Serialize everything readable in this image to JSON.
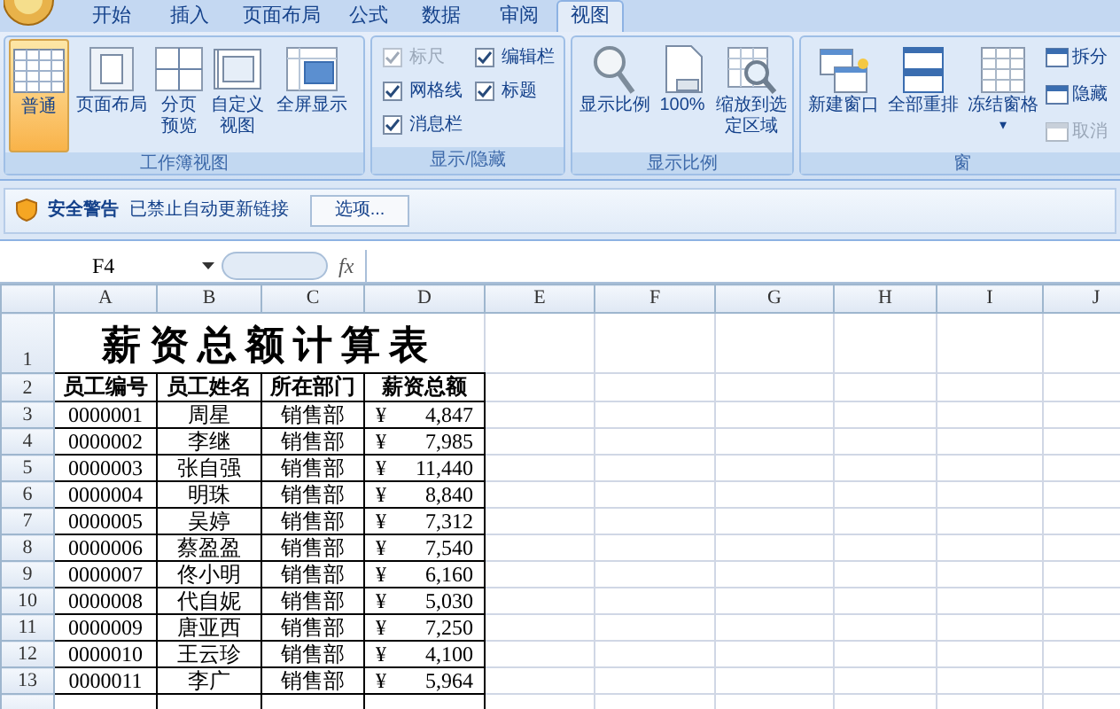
{
  "tabs": [
    {
      "label": "开始",
      "selected": false
    },
    {
      "label": "插入",
      "selected": false
    },
    {
      "label": "页面布局",
      "selected": false
    },
    {
      "label": "公式",
      "selected": false
    },
    {
      "label": "数据",
      "selected": false
    },
    {
      "label": "审阅",
      "selected": false
    },
    {
      "label": "视图",
      "selected": true
    }
  ],
  "ribbon_groups": [
    {
      "label": "工作簿视图",
      "items": [
        {
          "kind": "large",
          "label": "普通",
          "selected": true
        },
        {
          "kind": "large",
          "label": "页面布局",
          "selected": false
        },
        {
          "kind": "large",
          "label": "分页预览",
          "selected": false
        },
        {
          "kind": "large",
          "label": "自定义视图",
          "selected": false
        },
        {
          "kind": "large",
          "label": "全屏显示",
          "selected": false
        }
      ]
    },
    {
      "label": "显示/隐藏",
      "items": [
        {
          "kind": "check",
          "label": "标尺",
          "checked": true,
          "disabled": true
        },
        {
          "kind": "check",
          "label": "编辑栏",
          "checked": true,
          "disabled": false
        },
        {
          "kind": "check",
          "label": "网格线",
          "checked": true,
          "disabled": false
        },
        {
          "kind": "check",
          "label": "标题",
          "checked": true,
          "disabled": false
        },
        {
          "kind": "check",
          "label": "消息栏",
          "checked": true,
          "disabled": false
        }
      ]
    },
    {
      "label": "显示比例",
      "items": [
        {
          "kind": "large",
          "label": "显示比例",
          "selected": false
        },
        {
          "kind": "large",
          "label": "100%",
          "selected": false
        },
        {
          "kind": "large",
          "label": "缩放到选定区域",
          "selected": false
        }
      ]
    },
    {
      "label": "窗",
      "items": [
        {
          "kind": "large",
          "label": "新建窗口",
          "selected": false
        },
        {
          "kind": "large",
          "label": "全部重排",
          "selected": false
        },
        {
          "kind": "large",
          "label": "冻结窗格",
          "selected": false,
          "caret": "▾"
        },
        {
          "kind": "small",
          "label": "拆分",
          "disabled": false
        },
        {
          "kind": "small",
          "label": "隐藏",
          "disabled": false
        },
        {
          "kind": "small",
          "label": "取消",
          "disabled": true
        }
      ]
    }
  ],
  "message_bar": {
    "title": "安全警告",
    "text": "已禁止自动更新链接",
    "button": "选项..."
  },
  "formula_bar": {
    "name_box": "F4",
    "fx": "fx"
  },
  "sheet": {
    "columns": [
      "A",
      "B",
      "C",
      "D",
      "E",
      "F",
      "G",
      "H",
      "I",
      "J"
    ],
    "row_headers": [
      "1",
      "2",
      "3",
      "4",
      "5",
      "6",
      "7",
      "8",
      "9",
      "10",
      "11",
      "12",
      "13"
    ],
    "title": "薪资总额计算表",
    "headers": [
      "员工编号",
      "员工姓名",
      "所在部门",
      "薪资总额"
    ],
    "rows": [
      {
        "id": "0000001",
        "name": "周星",
        "dept": "销售部",
        "currency": "¥",
        "amount": "4,847"
      },
      {
        "id": "0000002",
        "name": "李继",
        "dept": "销售部",
        "currency": "¥",
        "amount": "7,985"
      },
      {
        "id": "0000003",
        "name": "张自强",
        "dept": "销售部",
        "currency": "¥",
        "amount": "11,440"
      },
      {
        "id": "0000004",
        "name": "明珠",
        "dept": "销售部",
        "currency": "¥",
        "amount": "8,840"
      },
      {
        "id": "0000005",
        "name": "吴婷",
        "dept": "销售部",
        "currency": "¥",
        "amount": "7,312"
      },
      {
        "id": "0000006",
        "name": "蔡盈盈",
        "dept": "销售部",
        "currency": "¥",
        "amount": "7,540"
      },
      {
        "id": "0000007",
        "name": "佟小明",
        "dept": "销售部",
        "currency": "¥",
        "amount": "6,160"
      },
      {
        "id": "0000008",
        "name": "代自妮",
        "dept": "销售部",
        "currency": "¥",
        "amount": "5,030"
      },
      {
        "id": "0000009",
        "name": "唐亚西",
        "dept": "销售部",
        "currency": "¥",
        "amount": "7,250"
      },
      {
        "id": "0000010",
        "name": "王云珍",
        "dept": "销售部",
        "currency": "¥",
        "amount": "4,100"
      },
      {
        "id": "0000011",
        "name": "李广",
        "dept": "销售部",
        "currency": "¥",
        "amount": "5,964"
      }
    ]
  }
}
